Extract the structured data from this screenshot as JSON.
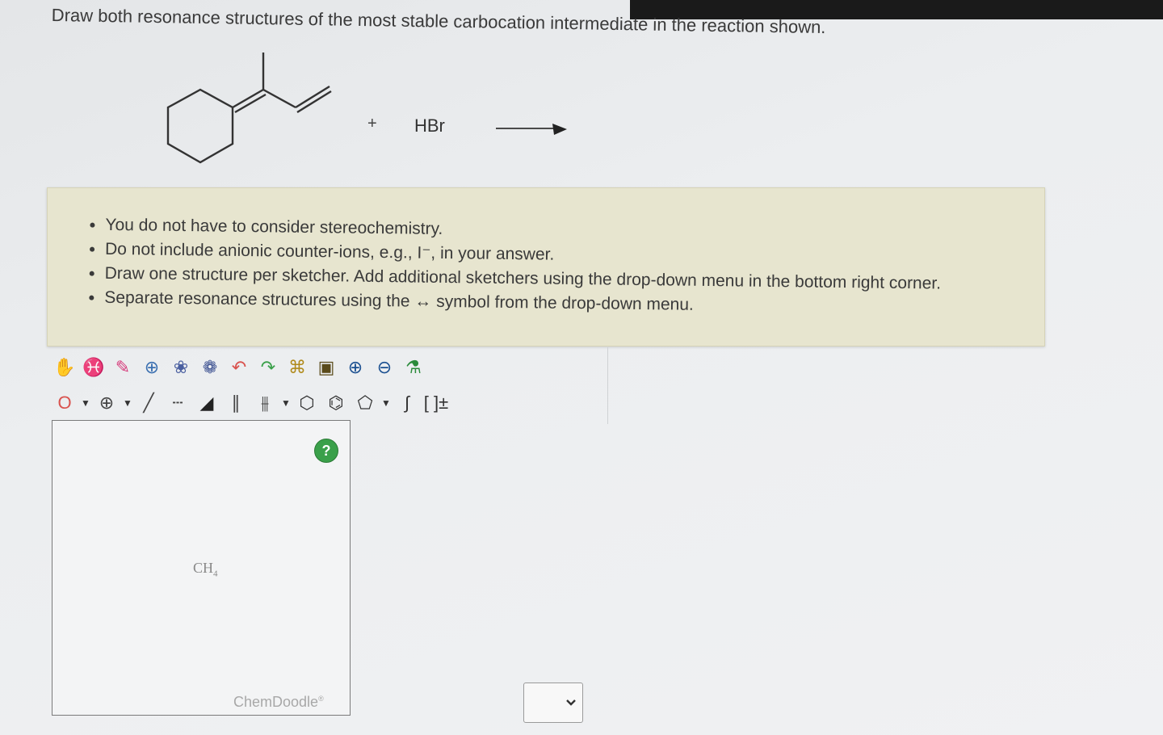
{
  "question": "Draw both resonance structures of the most stable carbocation intermediate in the reaction shown.",
  "reaction": {
    "plus": "+",
    "reagent": "HBr"
  },
  "instructions": [
    "You do not have to consider stereochemistry.",
    "Do not include anionic counter-ions, e.g., I⁻, in your answer.",
    "Draw one structure per sketcher. Add additional sketchers using the drop-down menu in the bottom right corner.",
    "Separate resonance structures using the ↔ symbol from the drop-down menu."
  ],
  "toolbar": {
    "row1": [
      {
        "name": "hand-icon",
        "glyph": "✋",
        "color": "#c0392b"
      },
      {
        "name": "lasso-icon",
        "glyph": "♓",
        "color": "#4a7f86"
      },
      {
        "name": "eraser-icon",
        "glyph": "✎",
        "color": "#d63a7a"
      },
      {
        "name": "center-icon",
        "glyph": "⊕",
        "color": "#3a6fb0"
      },
      {
        "name": "clean-icon",
        "glyph": "❀",
        "color": "#4a5fa0"
      },
      {
        "name": "clean-3d-icon",
        "glyph": "❁",
        "color": "#3a4f90"
      },
      {
        "name": "undo-icon",
        "glyph": "↶",
        "color": "#d9534f"
      },
      {
        "name": "redo-icon",
        "glyph": "↷",
        "color": "#3aa04a"
      },
      {
        "name": "templates-icon",
        "glyph": "⌘",
        "color": "#b08a1a"
      },
      {
        "name": "save-icon",
        "glyph": "▣",
        "color": "#5a4a1a"
      },
      {
        "name": "zoom-in-icon",
        "glyph": "⊕",
        "color": "#1a4f90"
      },
      {
        "name": "zoom-out-icon",
        "glyph": "⊖",
        "color": "#1a4f90"
      },
      {
        "name": "atom-settings-icon",
        "glyph": "⚗",
        "color": "#2a8a3a"
      }
    ],
    "row2": [
      {
        "name": "atom-o-icon",
        "glyph": "O",
        "color": "#d9534f",
        "caret": true
      },
      {
        "name": "charge-plus-icon",
        "glyph": "⊕",
        "color": "#444",
        "caret": true
      },
      {
        "name": "single-bond-icon",
        "glyph": "╱",
        "color": "#444"
      },
      {
        "name": "dashed-bond-icon",
        "glyph": "┄",
        "color": "#444"
      },
      {
        "name": "wedge-bond-icon",
        "glyph": "◢",
        "color": "#222"
      },
      {
        "name": "double-bond-icon",
        "glyph": "∥",
        "color": "#444"
      },
      {
        "name": "triple-bond-icon",
        "glyph": "⫵",
        "color": "#444",
        "caret": true
      },
      {
        "name": "cyclohexane-icon",
        "glyph": "⬡",
        "color": "#333"
      },
      {
        "name": "benzene-icon",
        "glyph": "⌬",
        "color": "#333"
      },
      {
        "name": "pentagon-ring-icon",
        "glyph": "⬠",
        "color": "#333",
        "caret": true
      },
      {
        "name": "polymer-bracket-icon",
        "glyph": "∫",
        "color": "#333"
      },
      {
        "name": "charge-bracket-icon",
        "glyph": "[ ]±",
        "color": "#333"
      }
    ]
  },
  "sketcher": {
    "ch4_main": "CH",
    "ch4_sub": "4",
    "help": "?",
    "brand": "ChemDoodle",
    "brand_mark": "®"
  },
  "dropdown": {
    "chevron": "⌵"
  }
}
